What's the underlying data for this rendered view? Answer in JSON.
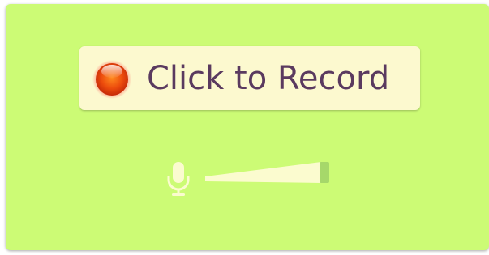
{
  "recorder": {
    "record_button": {
      "label": "Click to Record",
      "icon": "record-dot-icon"
    },
    "microphone": {
      "icon": "microphone-icon"
    },
    "input_level": {
      "icon": "volume-level-meter",
      "level_fraction": 0.92
    }
  },
  "colors": {
    "panel_background": "#ccfb75",
    "button_background": "#fcf9cf",
    "label_text": "#5a3a5f",
    "record_dot": "#e85a10",
    "meter_fill": "#fbfbcf",
    "meter_end": "#a6d86a"
  }
}
